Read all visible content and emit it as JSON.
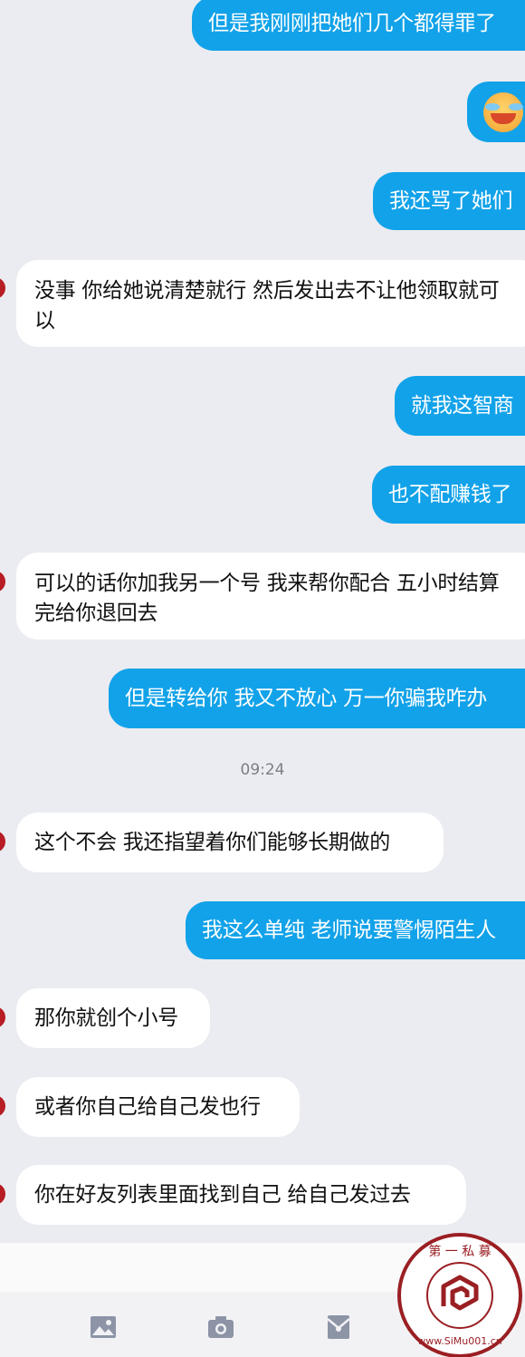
{
  "messages": [
    {
      "side": "out",
      "text": "但是我刚刚把她们几个都得罪了"
    },
    {
      "side": "out",
      "emoji": "crying-laughing-emoji"
    },
    {
      "side": "out",
      "text": "我还骂了她们"
    },
    {
      "side": "in",
      "text": "没事 你给她说清楚就行 然后发出去不让他领取就可以"
    },
    {
      "side": "out",
      "text": "就我这智商"
    },
    {
      "side": "out",
      "text": "也不配赚钱了"
    },
    {
      "side": "in",
      "text": "可以的话你加我另一个号 我来帮你配合 五小时结算完给你退回去"
    },
    {
      "side": "out",
      "text": "但是转给你 我又不放心 万一你骗我咋办"
    },
    {
      "side": "in",
      "text": "这个不会 我还指望着你们能够长期做的"
    },
    {
      "side": "out",
      "text": "我这么单纯 老师说要警惕陌生人"
    },
    {
      "side": "in",
      "text": "那你就创个小号"
    },
    {
      "side": "in",
      "text": "或者你自己给自己发也行"
    },
    {
      "side": "in",
      "text": "你在好友列表里面找到自己 给自己发过去"
    }
  ],
  "timestamp": "09:24",
  "toolbar": {
    "icons": [
      "image-icon",
      "camera-icon",
      "red-packet-icon"
    ]
  },
  "watermark": {
    "top_text": "第 一 私 募",
    "bottom_text": "www.SiMu001.cn"
  },
  "colors": {
    "background": "#ebecf1",
    "outgoing_bubble": "#12a2e9",
    "incoming_bubble": "#ffffff",
    "timestamp": "#7d7f86",
    "watermark": "#9a1f23"
  }
}
